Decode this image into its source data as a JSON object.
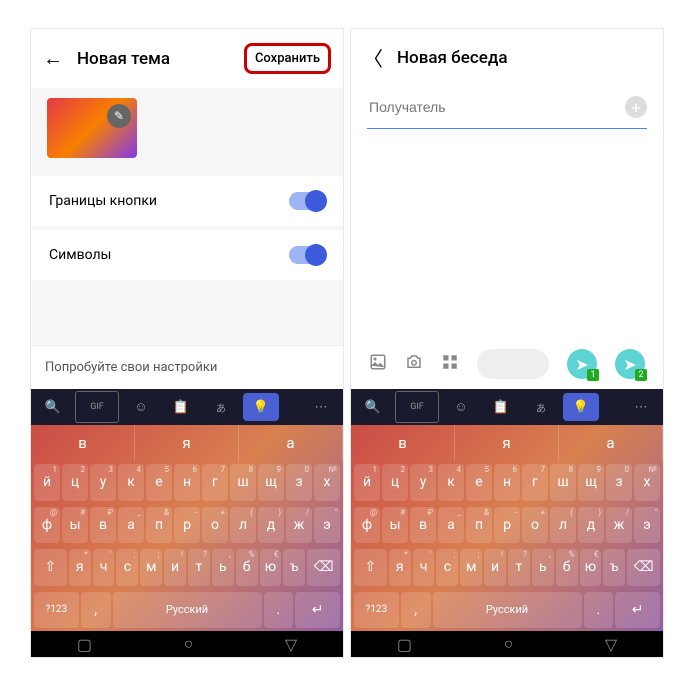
{
  "left": {
    "title": "Новая тема",
    "save": "Сохранить",
    "opt1": "Границы кнопки",
    "opt2": "Символы",
    "try": "Попробуйте свои настройки"
  },
  "right": {
    "title": "Новая беседа",
    "recipient": "Получатель"
  },
  "kb": {
    "sug": [
      "в",
      "я",
      "а"
    ],
    "r1": [
      "й",
      "ц",
      "у",
      "к",
      "е",
      "н",
      "г",
      "ш",
      "щ",
      "з",
      "х"
    ],
    "r1s": [
      "1",
      "2",
      "3",
      "4",
      "5",
      "6",
      "7",
      "8",
      "9",
      "0",
      "№"
    ],
    "r2": [
      "ф",
      "ы",
      "в",
      "а",
      "п",
      "р",
      "о",
      "л",
      "д",
      "ж",
      "э"
    ],
    "r2s": [
      "@",
      "#",
      "₽",
      "_",
      "&",
      "-",
      "+",
      "(",
      ")",
      "/",
      "\""
    ],
    "r3": [
      "я",
      "ч",
      "с",
      "м",
      "и",
      "т",
      "ь",
      "б",
      "ю",
      "ъ"
    ],
    "r3s": [
      "*",
      "'",
      ":",
      ";",
      "!",
      "?",
      ",",
      "%",
      "€"
    ],
    "lang": "Русский",
    "num": "?123"
  }
}
